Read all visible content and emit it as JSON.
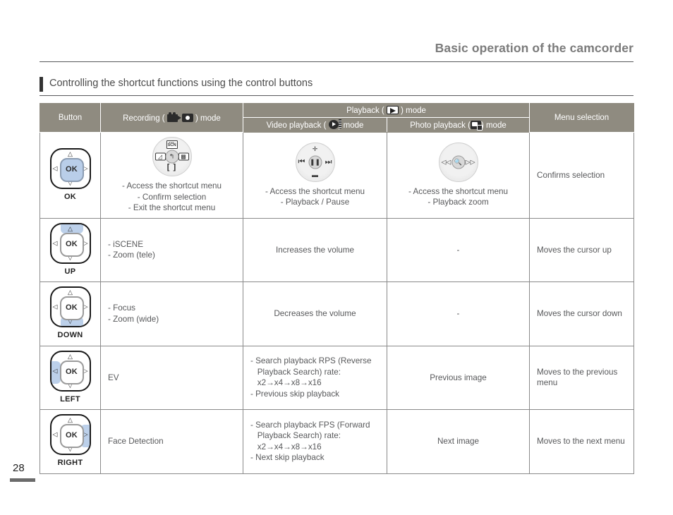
{
  "page": {
    "header_title": "Basic operation of the camcorder",
    "section_title": "Controlling the shortcut functions using the control buttons",
    "page_number": "28"
  },
  "table": {
    "headers": {
      "button": "Button",
      "recording_pre": "Recording ( ",
      "recording_post": " ) mode",
      "playback_pre": "Playback ( ",
      "playback_post": " ) mode",
      "video_playback_pre": "Video playback ( ",
      "video_playback_post": ") mode",
      "photo_playback_pre": "Photo playback (",
      "photo_playback_post": ") mode",
      "menu_selection": "Menu selection"
    },
    "rows": [
      {
        "button_label": "OK",
        "direction": "center",
        "recording": "- Access the shortcut menu\n- Confirm selection\n- Exit the shortcut menu",
        "recording_has_wheel": true,
        "video": "- Access the shortcut menu\n- Playback / Pause",
        "video_has_wheel": true,
        "photo": "- Access the shortcut menu\n- Playback zoom",
        "photo_has_wheel": true,
        "menu": "Confirms selection"
      },
      {
        "button_label": "UP",
        "direction": "up",
        "recording": "- iSCENE\n- Zoom (tele)",
        "recording_has_wheel": false,
        "video": "Increases the volume",
        "video_has_wheel": false,
        "photo": "-",
        "photo_has_wheel": false,
        "menu": "Moves the cursor up"
      },
      {
        "button_label": "DOWN",
        "direction": "down",
        "recording": "- Focus\n- Zoom (wide)",
        "recording_has_wheel": false,
        "video": "Decreases the volume",
        "video_has_wheel": false,
        "photo": "-",
        "photo_has_wheel": false,
        "menu": "Moves the cursor down"
      },
      {
        "button_label": "LEFT",
        "direction": "left",
        "recording": "EV",
        "recording_has_wheel": false,
        "video": "- Search playback RPS (Reverse\n   Playback Search) rate:\n   x2→x4→x8→x16\n- Previous skip playback",
        "video_has_wheel": false,
        "photo": "Previous image",
        "photo_has_wheel": false,
        "menu": "Moves to the previous menu"
      },
      {
        "button_label": "RIGHT",
        "direction": "right",
        "recording": "Face Detection",
        "recording_has_wheel": false,
        "video": "- Search playback FPS (Forward\n   Playback Search) rate:\n   x2→x4→x8→x16\n- Next skip playback",
        "video_has_wheel": false,
        "photo": "Next image",
        "photo_has_wheel": false,
        "menu": "Moves to the next menu"
      }
    ]
  },
  "wheels": {
    "recording_ok": {
      "top": "SCN",
      "left": "ev-icon",
      "center": "return-icon",
      "right": "face-detection-icon",
      "bottom": "focus-brackets-icon"
    },
    "video_ok": {
      "top": "volume-up-icon",
      "left": "skip-previous-icon",
      "center": "pause-icon",
      "right": "skip-next-icon",
      "bottom": "volume-down-icon"
    },
    "photo_ok": {
      "left": "previous-image-icon",
      "center": "zoom-icon",
      "right": "next-image-icon"
    }
  },
  "dpad": {
    "ok_label": "OK",
    "arrow_up": "△",
    "arrow_down": "▽",
    "arrow_left": "◁",
    "arrow_right": "▷"
  },
  "colors": {
    "header_band": "#8f8b80",
    "highlight": "#bcd0ea",
    "text": "#58595b",
    "title": "#7b7b7b"
  }
}
